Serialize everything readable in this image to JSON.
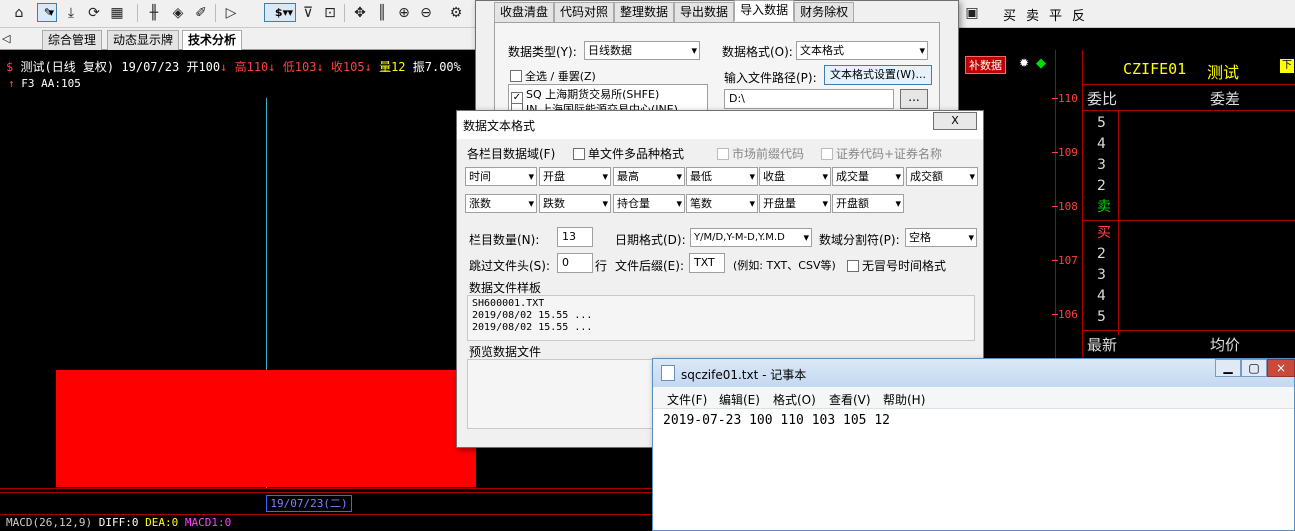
{
  "toolbar": {
    "icons": [
      "home-icon",
      "draw-icon",
      "download-icon",
      "refresh-icon",
      "grid-icon",
      "candles-icon",
      "diamond-icon",
      "edit-icon",
      "play-icon",
      "dollar-icon",
      "filter-icon",
      "chart-icon",
      "move-icon",
      "bar-icon",
      "zoom-in-icon",
      "zoom-out-icon",
      "settings-icon"
    ],
    "dollar": "$",
    "right": [
      "买",
      "卖",
      "平",
      "反"
    ]
  },
  "tabs": [
    {
      "label": "综合管理"
    },
    {
      "label": "动态显示牌"
    },
    {
      "label": "技术分析"
    }
  ],
  "chart": {
    "name": "测试",
    "period": "(日线 复权)",
    "date": "19/07/23",
    "open": "开100",
    "high": "高110",
    "low": "低103",
    "close": "收105",
    "vol": "量12",
    "amp": "振7.00%",
    "row2": "F3 AA:105",
    "date_box": "19/07/23(二)",
    "macd": "MACD(26,12,9)",
    "diff": "DIFF:0",
    "dea": "DEA:0",
    "macd1": "MACD1:0",
    "prices": [
      "110",
      "109",
      "108",
      "107",
      "106"
    ]
  },
  "bar": {
    "open": 100,
    "high": 110,
    "low": 103,
    "close": 105
  },
  "quote": {
    "badge": "补数据",
    "code": "CZIFE01",
    "name": "测试",
    "mark": "下",
    "wb": "委比",
    "wc": "委差",
    "sell": [
      "5",
      "4",
      "3",
      "2"
    ],
    "sell_label": "卖",
    "buy_label": "买",
    "buy": [
      "2",
      "3",
      "4",
      "5"
    ],
    "latest": "最新",
    "avg": "均价"
  },
  "import": {
    "tabs": [
      "收盘清盘",
      "代码对照",
      "整理数据",
      "导出数据",
      "导入数据",
      "财务除权"
    ],
    "type_label": "数据类型(Y):",
    "type_val": "日线数据",
    "format_label": "数据格式(O):",
    "format_val": "文本格式",
    "select_all": "全选 / 垂罢(Z)",
    "list": [
      "SQ 上海期货交易所(SHFE)",
      "IN 上海国际能源交易中心(INE)"
    ],
    "path_label": "输入文件路径(P):",
    "format_btn": "文本格式设置(W)...",
    "path": "D:\\",
    "browse": "..."
  },
  "dlg": {
    "title": "数据文本格式",
    "fields_label": "各栏目数据域(F)",
    "multi": "单文件多品种格式",
    "market": "市场前缀代码",
    "code_name": "证券代码+证券名称",
    "row1": [
      "时间",
      "开盘",
      "最高",
      "最低",
      "收盘",
      "成交量",
      "成交额"
    ],
    "row2": [
      "涨数",
      "跌数",
      "持仓量",
      "笔数",
      "开盘量",
      "开盘额"
    ],
    "count_label": "栏目数量(N):",
    "count": "13",
    "datefmt_label": "日期格式(D):",
    "datefmt": "Y/M/D,Y-M-D,Y.M.D",
    "sep_label": "数域分割符(P):",
    "sep": "空格",
    "skip_label": "跳过文件头(S):",
    "skip": "0",
    "skip_unit": "行",
    "ext_label": "文件后缀(E):",
    "ext": "TXT",
    "ext_hint": "(例如: TXT、CSV等)",
    "nosymbol": "无冒号时间格式",
    "sample_label": "数据文件样板",
    "sample": [
      "SH600001.TXT",
      "2019/08/02 15.55 ...",
      "2019/08/02 15.55 ..."
    ],
    "preview_label": "预览数据文件",
    "close": "X"
  },
  "notepad": {
    "title": "sqczife01.txt - 记事本",
    "menu": [
      "文件(F)",
      "编辑(E)",
      "格式(O)",
      "查看(V)",
      "帮助(H)"
    ],
    "content": "2019-07-23 100 110 103 105 12"
  }
}
